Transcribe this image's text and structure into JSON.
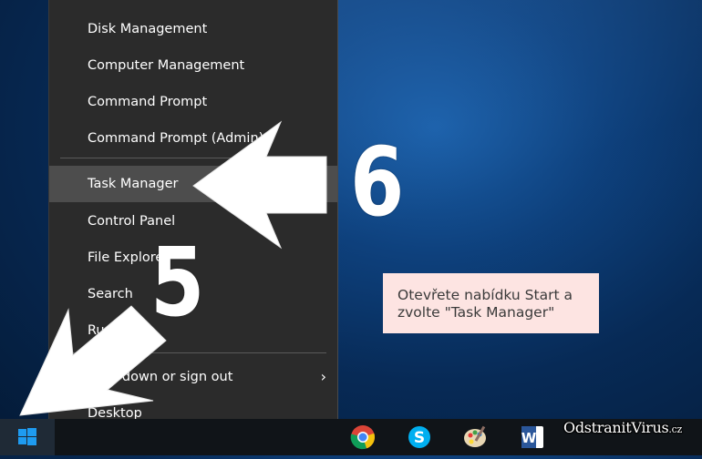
{
  "context_menu": {
    "items": [
      {
        "label": "Disk Management",
        "selected": false
      },
      {
        "label": "Computer Management",
        "selected": false
      },
      {
        "label": "Command Prompt",
        "selected": false
      },
      {
        "label": "Command Prompt (Admin)",
        "selected": false
      },
      {
        "label": "Task Manager",
        "selected": true
      },
      {
        "label": "Control Panel",
        "selected": false
      },
      {
        "label": "File Explorer",
        "selected": false
      },
      {
        "label": "Search",
        "selected": false
      },
      {
        "label": "Run",
        "selected": false
      },
      {
        "label": "Shut down or sign out",
        "selected": false,
        "has_submenu": true
      },
      {
        "label": "Desktop",
        "selected": false
      }
    ]
  },
  "annotations": {
    "step_a": "5",
    "step_b": "6",
    "caption_line1": "Otevřete nabídku Start a",
    "caption_line2": "zvolte \"Task Manager\""
  },
  "taskbar": {
    "icons": [
      "windows-start-icon",
      "chrome-icon",
      "skype-icon",
      "paint-icon",
      "word-icon"
    ]
  },
  "watermark": {
    "text": "OdstranitVirus",
    "suffix": ".cz"
  },
  "colors": {
    "menu_bg": "#2b2b2b",
    "menu_selected": "#4d4d4d",
    "caption_bg": "#fde4e2",
    "start_blue": "#1e9bf0"
  }
}
